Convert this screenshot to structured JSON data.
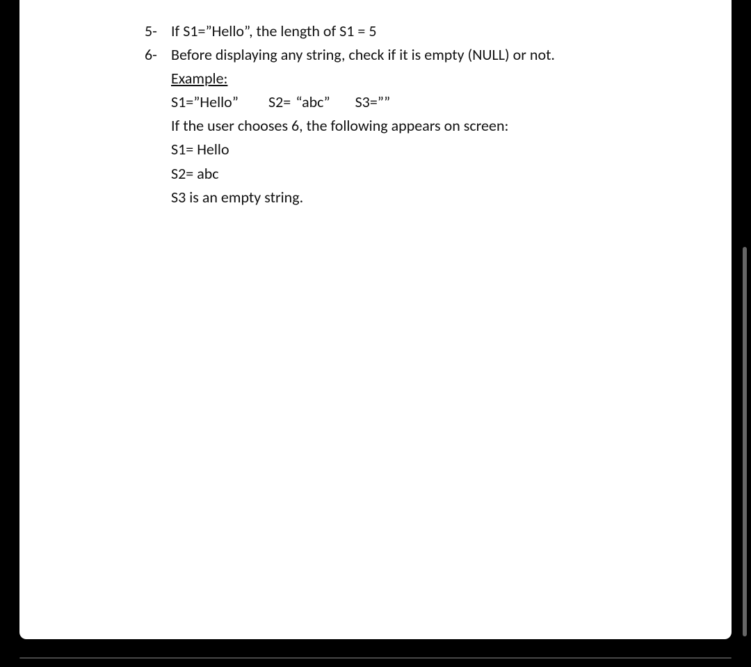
{
  "items": [
    {
      "marker": "5-",
      "text": "If S1=”Hello”, the length of S1 = 5"
    },
    {
      "marker": "6-",
      "lead": "Before displaying any string, check if it is empty (NULL) or not.",
      "example_label": "Example:",
      "vars_line_parts": [
        "S1=”Hello”",
        "S2= “abc”",
        "S3=””"
      ],
      "choose_line": "If the user chooses 6, the following appears on screen:",
      "out1": "S1= Hello",
      "out2": "S2= abc",
      "out3": "S3 is an empty string."
    }
  ]
}
